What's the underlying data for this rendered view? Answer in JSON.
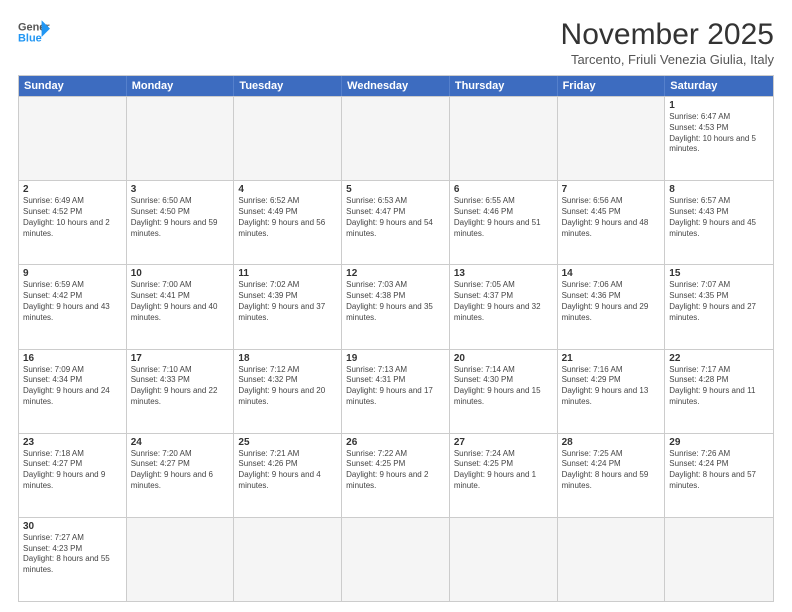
{
  "header": {
    "logo_line1": "General",
    "logo_line2": "Blue",
    "title": "November 2025",
    "subtitle": "Tarcento, Friuli Venezia Giulia, Italy"
  },
  "weekdays": [
    "Sunday",
    "Monday",
    "Tuesday",
    "Wednesday",
    "Thursday",
    "Friday",
    "Saturday"
  ],
  "rows": [
    [
      {
        "day": "",
        "info": "",
        "empty": true
      },
      {
        "day": "",
        "info": "",
        "empty": true
      },
      {
        "day": "",
        "info": "",
        "empty": true
      },
      {
        "day": "",
        "info": "",
        "empty": true
      },
      {
        "day": "",
        "info": "",
        "empty": true
      },
      {
        "day": "",
        "info": "",
        "empty": true
      },
      {
        "day": "1",
        "info": "Sunrise: 6:47 AM\nSunset: 4:53 PM\nDaylight: 10 hours and 5 minutes.",
        "empty": false
      }
    ],
    [
      {
        "day": "2",
        "info": "Sunrise: 6:49 AM\nSunset: 4:52 PM\nDaylight: 10 hours and 2 minutes.",
        "empty": false
      },
      {
        "day": "3",
        "info": "Sunrise: 6:50 AM\nSunset: 4:50 PM\nDaylight: 9 hours and 59 minutes.",
        "empty": false
      },
      {
        "day": "4",
        "info": "Sunrise: 6:52 AM\nSunset: 4:49 PM\nDaylight: 9 hours and 56 minutes.",
        "empty": false
      },
      {
        "day": "5",
        "info": "Sunrise: 6:53 AM\nSunset: 4:47 PM\nDaylight: 9 hours and 54 minutes.",
        "empty": false
      },
      {
        "day": "6",
        "info": "Sunrise: 6:55 AM\nSunset: 4:46 PM\nDaylight: 9 hours and 51 minutes.",
        "empty": false
      },
      {
        "day": "7",
        "info": "Sunrise: 6:56 AM\nSunset: 4:45 PM\nDaylight: 9 hours and 48 minutes.",
        "empty": false
      },
      {
        "day": "8",
        "info": "Sunrise: 6:57 AM\nSunset: 4:43 PM\nDaylight: 9 hours and 45 minutes.",
        "empty": false
      }
    ],
    [
      {
        "day": "9",
        "info": "Sunrise: 6:59 AM\nSunset: 4:42 PM\nDaylight: 9 hours and 43 minutes.",
        "empty": false
      },
      {
        "day": "10",
        "info": "Sunrise: 7:00 AM\nSunset: 4:41 PM\nDaylight: 9 hours and 40 minutes.",
        "empty": false
      },
      {
        "day": "11",
        "info": "Sunrise: 7:02 AM\nSunset: 4:39 PM\nDaylight: 9 hours and 37 minutes.",
        "empty": false
      },
      {
        "day": "12",
        "info": "Sunrise: 7:03 AM\nSunset: 4:38 PM\nDaylight: 9 hours and 35 minutes.",
        "empty": false
      },
      {
        "day": "13",
        "info": "Sunrise: 7:05 AM\nSunset: 4:37 PM\nDaylight: 9 hours and 32 minutes.",
        "empty": false
      },
      {
        "day": "14",
        "info": "Sunrise: 7:06 AM\nSunset: 4:36 PM\nDaylight: 9 hours and 29 minutes.",
        "empty": false
      },
      {
        "day": "15",
        "info": "Sunrise: 7:07 AM\nSunset: 4:35 PM\nDaylight: 9 hours and 27 minutes.",
        "empty": false
      }
    ],
    [
      {
        "day": "16",
        "info": "Sunrise: 7:09 AM\nSunset: 4:34 PM\nDaylight: 9 hours and 24 minutes.",
        "empty": false
      },
      {
        "day": "17",
        "info": "Sunrise: 7:10 AM\nSunset: 4:33 PM\nDaylight: 9 hours and 22 minutes.",
        "empty": false
      },
      {
        "day": "18",
        "info": "Sunrise: 7:12 AM\nSunset: 4:32 PM\nDaylight: 9 hours and 20 minutes.",
        "empty": false
      },
      {
        "day": "19",
        "info": "Sunrise: 7:13 AM\nSunset: 4:31 PM\nDaylight: 9 hours and 17 minutes.",
        "empty": false
      },
      {
        "day": "20",
        "info": "Sunrise: 7:14 AM\nSunset: 4:30 PM\nDaylight: 9 hours and 15 minutes.",
        "empty": false
      },
      {
        "day": "21",
        "info": "Sunrise: 7:16 AM\nSunset: 4:29 PM\nDaylight: 9 hours and 13 minutes.",
        "empty": false
      },
      {
        "day": "22",
        "info": "Sunrise: 7:17 AM\nSunset: 4:28 PM\nDaylight: 9 hours and 11 minutes.",
        "empty": false
      }
    ],
    [
      {
        "day": "23",
        "info": "Sunrise: 7:18 AM\nSunset: 4:27 PM\nDaylight: 9 hours and 9 minutes.",
        "empty": false
      },
      {
        "day": "24",
        "info": "Sunrise: 7:20 AM\nSunset: 4:27 PM\nDaylight: 9 hours and 6 minutes.",
        "empty": false
      },
      {
        "day": "25",
        "info": "Sunrise: 7:21 AM\nSunset: 4:26 PM\nDaylight: 9 hours and 4 minutes.",
        "empty": false
      },
      {
        "day": "26",
        "info": "Sunrise: 7:22 AM\nSunset: 4:25 PM\nDaylight: 9 hours and 2 minutes.",
        "empty": false
      },
      {
        "day": "27",
        "info": "Sunrise: 7:24 AM\nSunset: 4:25 PM\nDaylight: 9 hours and 1 minute.",
        "empty": false
      },
      {
        "day": "28",
        "info": "Sunrise: 7:25 AM\nSunset: 4:24 PM\nDaylight: 8 hours and 59 minutes.",
        "empty": false
      },
      {
        "day": "29",
        "info": "Sunrise: 7:26 AM\nSunset: 4:24 PM\nDaylight: 8 hours and 57 minutes.",
        "empty": false
      }
    ],
    [
      {
        "day": "30",
        "info": "Sunrise: 7:27 AM\nSunset: 4:23 PM\nDaylight: 8 hours and 55 minutes.",
        "empty": false
      },
      {
        "day": "",
        "info": "",
        "empty": true
      },
      {
        "day": "",
        "info": "",
        "empty": true
      },
      {
        "day": "",
        "info": "",
        "empty": true
      },
      {
        "day": "",
        "info": "",
        "empty": true
      },
      {
        "day": "",
        "info": "",
        "empty": true
      },
      {
        "day": "",
        "info": "",
        "empty": true
      }
    ]
  ]
}
